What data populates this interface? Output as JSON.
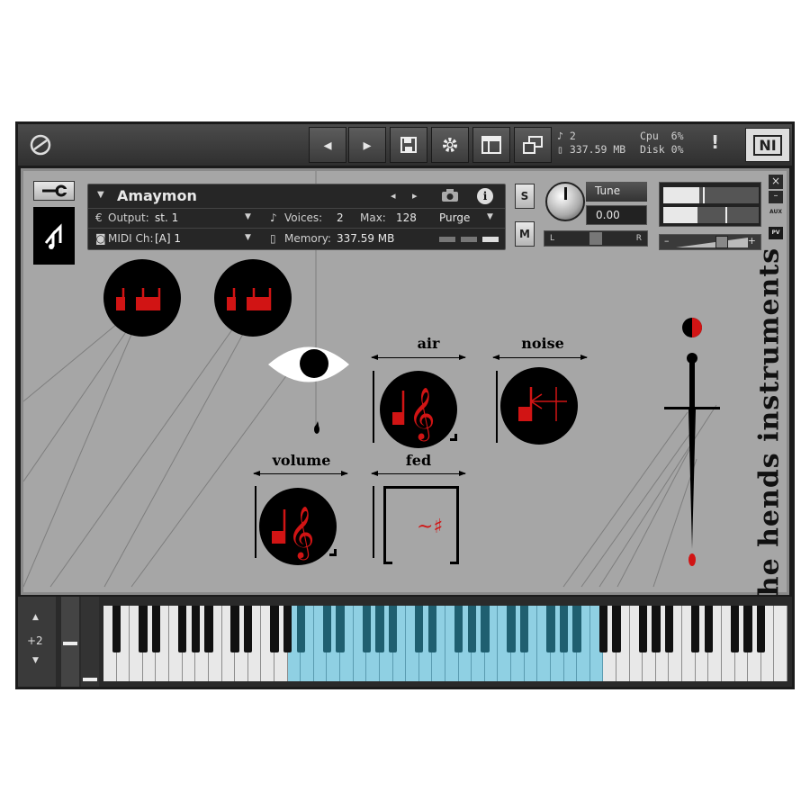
{
  "toolbar": {
    "stats": {
      "voices": "2",
      "memory": "337.59 MB",
      "cpu_label": "Cpu",
      "cpu_value": "6%",
      "disk_label": "Disk",
      "disk_value": "0%"
    },
    "alert": "!",
    "brand": "NI"
  },
  "instrument": {
    "name": "Amaymon",
    "output_label": "Output:",
    "output_value": "st. 1",
    "voices_label": "Voices:",
    "voices_value": "2",
    "max_label": "Max:",
    "max_value": "128",
    "purge_label": "Purge",
    "midi_label": "MIDI Ch:",
    "midi_value": "[A]  1",
    "memory_label": "Memory:",
    "memory_value": "337.59 MB",
    "solo": "S",
    "mute": "M",
    "tune_label": "Tune",
    "tune_value": "0.00",
    "pan_left": "L",
    "pan_right": "R",
    "aux": "AUX",
    "pv": "PV",
    "close": "×",
    "minimize": "–",
    "volume_minus": "–",
    "volume_plus": "+"
  },
  "controls": {
    "air": "air",
    "noise": "noise",
    "volume": "volume",
    "fed": "fed",
    "fed_symbol": "~♯"
  },
  "branding": {
    "vertical_text": "the hends instruments"
  },
  "keyboard": {
    "octave_shift": "+2",
    "octave_up": "▲",
    "octave_down": "▼"
  },
  "colors": {
    "accent_red": "#d11414",
    "key_highlight": "#8fd0e3"
  },
  "icons": {
    "toolbar": [
      "ni-logo-icon",
      "arrow-left-icon",
      "arrow-right-icon",
      "save-icon",
      "gear-icon",
      "layout-icon",
      "resize-icon"
    ],
    "header": [
      "wrench-icon",
      "camera-icon",
      "info-icon"
    ]
  }
}
